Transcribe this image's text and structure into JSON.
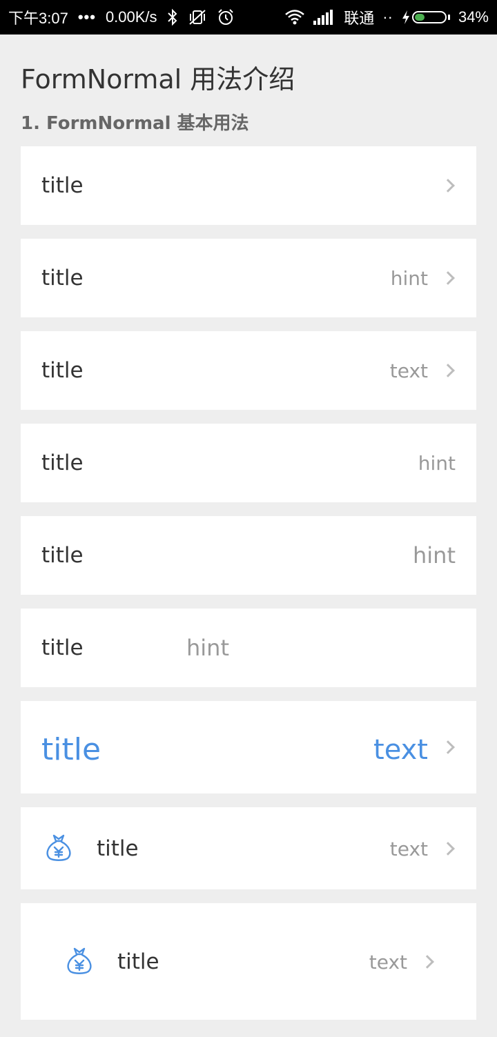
{
  "status_bar": {
    "time": "下午3:07",
    "dots": "•••",
    "speed": "0.00K/s",
    "carrier": "联通",
    "carrier_dots": "··",
    "battery_percent": "34%",
    "battery_level": 0.34
  },
  "page": {
    "title": "FormNormal 用法介绍",
    "section": "1. FormNormal 基本用法"
  },
  "accent_color": "#4a90e2",
  "rows": [
    {
      "title": "title",
      "value": "",
      "arrow": true
    },
    {
      "title": "title",
      "value": "hint",
      "arrow": true
    },
    {
      "title": "title",
      "value": "text",
      "arrow": true
    },
    {
      "title": "title",
      "value": "hint",
      "arrow": false
    },
    {
      "title": "title",
      "value": "hint",
      "arrow": false
    },
    {
      "title": "title",
      "value": "hint",
      "arrow": false
    },
    {
      "title": "title",
      "value": "text",
      "arrow": true
    },
    {
      "title": "title",
      "value": "text",
      "arrow": true,
      "icon": "money-bag-icon"
    },
    {
      "title": "title",
      "value": "text",
      "arrow": true,
      "icon": "money-bag-icon"
    }
  ]
}
